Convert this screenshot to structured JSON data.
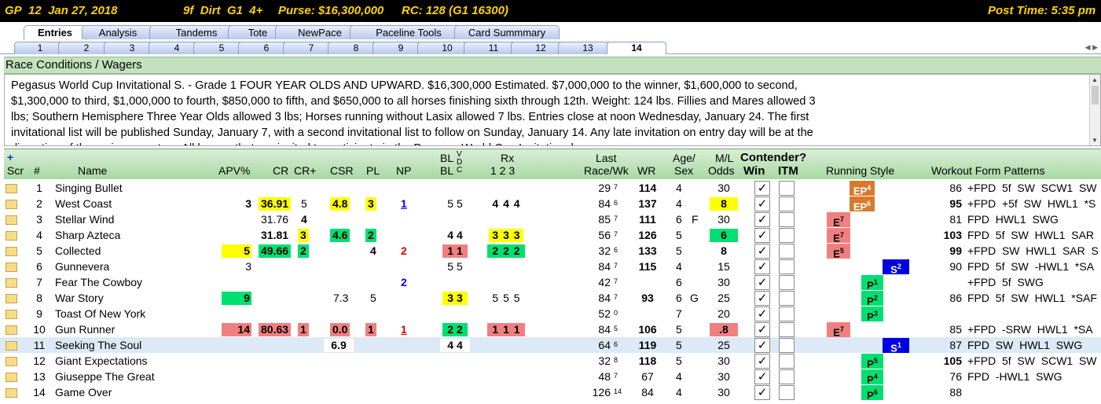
{
  "header": {
    "track": "GP",
    "race": "12",
    "date": "Jan 27, 2018",
    "distance": "9f",
    "surface": "Dirt",
    "grade": "G1",
    "age": "4+",
    "purse": "Purse: $16,300,000",
    "rc": "RC: 128 (G1 16300)",
    "post_time": "Post Time: 5:35 pm"
  },
  "main_tabs": [
    "Entries",
    "Analysis",
    "Tandems",
    "Tote",
    "NewPace",
    "Paceline Tools",
    "Card Summmary"
  ],
  "race_tabs": [
    "1",
    "2",
    "3",
    "4",
    "5",
    "6",
    "7",
    "8",
    "9",
    "10",
    "11",
    "12",
    "13",
    "14"
  ],
  "conditions": {
    "title": "Race Conditions / Wagers",
    "text": "Pegasus World Cup Invitational S. - Grade 1 FOUR YEAR OLDS AND UPWARD. $16,300,000 Estimated. $7,000,000 to the winner, $1,600,000 to second, $1,300,000 to third, $1,000,000 to fourth, $850,000 to fifth, and $650,000 to all horses finishing sixth through 12th. Weight: 124 lbs. Fillies and Mares allowed 3 lbs; Southern Hemisphere Three Year Olds allowed 3 lbs; Horses running without Lasix allowed 7 lbs. Entries close at noon Wednesday, January 24. The first invitational list will be published Sunday, January 7, with a second invitational list to follow on Sunday, January 14. Any late invitation on entry day will be at the discretion of the racing secretary. All horses that are invited to participate in the Pegasus World Cup Invitational"
  },
  "columns": {
    "plus": "+",
    "scr": "Scr",
    "num": "#",
    "name": "Name",
    "apv": "APV%",
    "cr": "CR",
    "crplus": "CR+",
    "csr": "CSR",
    "pl": "PL",
    "np": "NP",
    "bl_top": "BL",
    "bl_bot": "BL",
    "vdc_v": "V",
    "vdc_d": "D",
    "vdc_c": "C",
    "rx_top": "Rx",
    "rx_bot": "1 2 3",
    "last_top": "Last",
    "last_bot": "Race/Wk",
    "wr": "WR",
    "agesex_top": "Age/",
    "agesex_bot": "Sex",
    "ml_top": "M/L",
    "ml_bot": "Odds",
    "contender": "Contender?",
    "win": "Win",
    "itm": "ITM",
    "running_style": "Running Style",
    "workout": "Workout Form Patterns"
  },
  "entries": [
    {
      "num": "1",
      "name": "Singing Bullet",
      "apv": "",
      "cr": "",
      "crplus": "",
      "csr": "",
      "pl": "",
      "np": "",
      "bl": "",
      "rx": "",
      "last": "29",
      "wk": "7",
      "wr": "114",
      "age": "4",
      "sex": "",
      "ml": "30",
      "win": "✓",
      "rs": "EP",
      "rsn": "4",
      "rsk": "ep",
      "wo_num": "86",
      "wo": "+FPD  5f  SW  SCW1  SW"
    },
    {
      "num": "2",
      "name": "West Coast",
      "apv": "3",
      "cr": "36.91",
      "crplus": "5",
      "csr": "4.8",
      "pl": "3",
      "np": "1",
      "bl": "5 5",
      "rx": "4 4 4",
      "last": "84",
      "wk": "6",
      "wr": "137",
      "age": "4",
      "sex": "",
      "ml": "8",
      "win": "✓",
      "rs": "EP",
      "rsn": "6",
      "rsk": "ep",
      "wo_num": "95",
      "wo": "+FPD  +5f  SW  HWL1  *S"
    },
    {
      "num": "3",
      "name": "Stellar Wind",
      "apv": "",
      "cr": "31.76",
      "crplus": "4",
      "csr": "",
      "pl": "",
      "np": "",
      "bl": "",
      "rx": "",
      "last": "85",
      "wk": "7",
      "wr": "111",
      "age": "6",
      "sex": "F",
      "ml": "30",
      "win": "✓",
      "rs": "E",
      "rsn": "7",
      "rsk": "e",
      "wo_num": "81",
      "wo": "FPD  HWL1  SWG"
    },
    {
      "num": "4",
      "name": "Sharp Azteca",
      "apv": "",
      "cr": "31.81",
      "crplus": "3",
      "csr": "4.6",
      "pl": "2",
      "np": "",
      "bl": "4 4",
      "rx": "3 3 3",
      "last": "56",
      "wk": "7",
      "wr": "126",
      "age": "5",
      "sex": "",
      "ml": "6",
      "win": "✓",
      "rs": "E",
      "rsn": "7",
      "rsk": "e",
      "wo_num": "103",
      "wo": "FPD  5f  SW  HWL1  SAR"
    },
    {
      "num": "5",
      "name": "Collected",
      "apv": "5",
      "cr": "49.66",
      "crplus": "2",
      "csr": "",
      "pl": "4",
      "np": "2",
      "bl": "1 1",
      "rx": "2 2 2",
      "last": "32",
      "wk": "6",
      "wr": "133",
      "age": "5",
      "sex": "",
      "ml": "8",
      "win": "✓",
      "rs": "E",
      "rsn": "5",
      "rsk": "e",
      "wo_num": "99",
      "wo": "+FPD  SW  HWL1  SAR  S"
    },
    {
      "num": "6",
      "name": "Gunnevera",
      "apv": "3",
      "cr": "",
      "crplus": "",
      "csr": "",
      "pl": "",
      "np": "",
      "bl": "5 5",
      "rx": "",
      "last": "84",
      "wk": "7",
      "wr": "115",
      "age": "4",
      "sex": "",
      "ml": "15",
      "win": "✓",
      "rs": "S",
      "rsn": "2",
      "rsk": "s",
      "wo_num": "90",
      "wo": "FPD  5f  SW  -HWL1  *SA"
    },
    {
      "num": "7",
      "name": "Fear The Cowboy",
      "apv": "",
      "cr": "",
      "crplus": "",
      "csr": "",
      "pl": "",
      "np": "2",
      "bl": "",
      "rx": "",
      "last": "42",
      "wk": "7",
      "wr": "",
      "age": "6",
      "sex": "",
      "ml": "30",
      "win": "✓",
      "rs": "P",
      "rsn": "1",
      "rsk": "p",
      "wo_num": "",
      "wo": "+FPD  5f  SWG"
    },
    {
      "num": "8",
      "name": "War Story",
      "apv": "9",
      "cr": "",
      "crplus": "",
      "csr": "7.3",
      "pl": "5",
      "np": "",
      "bl": "3 3",
      "rx": "5 5 5",
      "last": "84",
      "wk": "7",
      "wr": "93",
      "age": "6",
      "sex": "G",
      "ml": "25",
      "win": "✓",
      "rs": "P",
      "rsn": "2",
      "rsk": "p",
      "wo_num": "86",
      "wo": "FPD  5f  SW  HWL1  *SAF"
    },
    {
      "num": "9",
      "name": "Toast Of New York",
      "apv": "",
      "cr": "",
      "crplus": "",
      "csr": "",
      "pl": "",
      "np": "",
      "bl": "",
      "rx": "",
      "last": "52",
      "wk": "0",
      "wr": "",
      "age": "7",
      "sex": "",
      "ml": "20",
      "win": "✓",
      "rs": "P",
      "rsn": "3",
      "rsk": "p",
      "wo_num": "",
      "wo": ""
    },
    {
      "num": "10",
      "name": "Gun Runner",
      "apv": "14",
      "cr": "80.63",
      "crplus": "1",
      "csr": "0.0",
      "pl": "1",
      "np": "1",
      "bl": "2 2",
      "rx": "1 1 1",
      "last": "84",
      "wk": "5",
      "wr": "106",
      "age": "5",
      "sex": "",
      "ml": ".8",
      "win": "✓",
      "rs": "E",
      "rsn": "7",
      "rsk": "e",
      "wo_num": "85",
      "wo": "+FPD  -SRW  HWL1  *SA"
    },
    {
      "num": "11",
      "name": "Seeking The Soul",
      "apv": "",
      "cr": "",
      "crplus": "",
      "csr": "6.9",
      "pl": "",
      "np": "",
      "bl": "4 4",
      "rx": "",
      "last": "64",
      "wk": "6",
      "wr": "119",
      "age": "5",
      "sex": "",
      "ml": "25",
      "win": "✓",
      "rs": "S",
      "rsn": "1",
      "rsk": "s",
      "wo_num": "87",
      "wo": "FPD  SW  HWL1  SWG"
    },
    {
      "num": "12",
      "name": "Giant Expectations",
      "apv": "",
      "cr": "",
      "crplus": "",
      "csr": "",
      "pl": "",
      "np": "",
      "bl": "",
      "rx": "",
      "last": "32",
      "wk": "8",
      "wr": "118",
      "age": "5",
      "sex": "",
      "ml": "30",
      "win": "✓",
      "rs": "P",
      "rsn": "5",
      "rsk": "p",
      "wo_num": "105",
      "wo": "+FPD  5f  SW  SCW1  SW"
    },
    {
      "num": "13",
      "name": "Giuseppe The Great",
      "apv": "",
      "cr": "",
      "crplus": "",
      "csr": "",
      "pl": "",
      "np": "",
      "bl": "",
      "rx": "",
      "last": "48",
      "wk": "7",
      "wr": "67",
      "age": "4",
      "sex": "",
      "ml": "30",
      "win": "✓",
      "rs": "P",
      "rsn": "4",
      "rsk": "p",
      "wo_num": "76",
      "wo": "FPD  -HWL1  SWG"
    },
    {
      "num": "14",
      "name": "Game Over",
      "apv": "",
      "cr": "",
      "crplus": "",
      "csr": "",
      "pl": "",
      "np": "",
      "bl": "",
      "rx": "",
      "last": "126",
      "wk": "14",
      "wr": "84",
      "age": "4",
      "sex": "",
      "ml": "30",
      "win": "✓",
      "rs": "P",
      "rsn": "6",
      "rsk": "p",
      "wo_num": "88",
      "wo": ""
    }
  ]
}
